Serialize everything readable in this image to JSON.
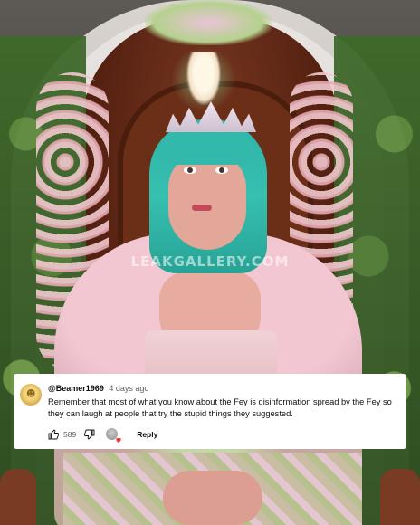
{
  "watermark": "LEAKGALLERY.COM",
  "comment": {
    "username": "@Beamer1969",
    "timestamp": "4 days ago",
    "text": "Remember that most of what you know about the Fey is disinformation spread by the Fey so they can laugh at people that try the stupid things they suggested.",
    "like_count": "589",
    "reply_label": "Reply",
    "icons": {
      "like": "thumbs-up-icon",
      "dislike": "thumbs-down-icon",
      "creator_heart": "heart-icon"
    },
    "colors": {
      "heart": "#e53935",
      "text": "#0f0f0f",
      "secondary_text": "#606060"
    }
  }
}
